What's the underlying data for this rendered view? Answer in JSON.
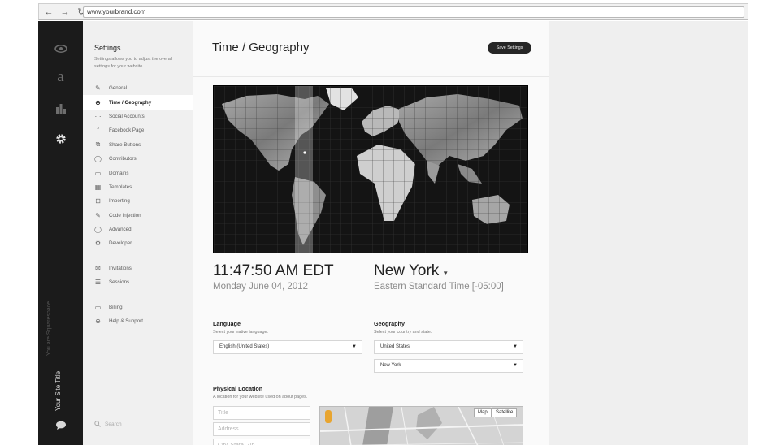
{
  "browser": {
    "url": "www.yourbrand.com",
    "back_glyph": "←",
    "forward_glyph": "→",
    "reload_glyph": "↻"
  },
  "rail": {
    "icons": [
      "eye-icon",
      "font-a-icon",
      "bar-chart-icon",
      "gear-icon"
    ],
    "a_glyph": "a",
    "site_title": "Your Site Title",
    "watermark": "You are Squarespace."
  },
  "settings_panel": {
    "heading": "Settings",
    "description": "Settings allows you to adjust the overall settings for your website.",
    "groups": [
      [
        {
          "label": "General",
          "icon": "wrench-icon",
          "glyph": "✎"
        },
        {
          "label": "Time / Geography",
          "icon": "globe-icon",
          "glyph": "⊕",
          "active": true
        },
        {
          "label": "Social Accounts",
          "icon": "share-icon",
          "glyph": "⋯"
        },
        {
          "label": "Facebook Page",
          "icon": "facebook-icon",
          "glyph": "f"
        },
        {
          "label": "Share Buttons",
          "icon": "share-buttons-icon",
          "glyph": "⧉"
        },
        {
          "label": "Contributors",
          "icon": "contributors-icon",
          "glyph": "◯"
        },
        {
          "label": "Domains",
          "icon": "domains-icon",
          "glyph": "▭"
        },
        {
          "label": "Templates",
          "icon": "templates-icon",
          "glyph": "▦"
        },
        {
          "label": "Importing",
          "icon": "importing-icon",
          "glyph": "⊞"
        },
        {
          "label": "Code Injection",
          "icon": "code-icon",
          "glyph": "✎"
        },
        {
          "label": "Advanced",
          "icon": "advanced-icon",
          "glyph": "◯"
        },
        {
          "label": "Developer",
          "icon": "developer-icon",
          "glyph": "⚙"
        }
      ],
      [
        {
          "label": "Invitations",
          "icon": "envelope-icon",
          "glyph": "✉"
        },
        {
          "label": "Sessions",
          "icon": "sessions-icon",
          "glyph": "☰"
        }
      ],
      [
        {
          "label": "Billing",
          "icon": "credit-card-icon",
          "glyph": "▭"
        },
        {
          "label": "Help & Support",
          "icon": "help-icon",
          "glyph": "⊕"
        }
      ]
    ],
    "search_placeholder": "Search"
  },
  "main": {
    "title": "Time / Geography",
    "save_label": "Save Settings",
    "time": "11:47:50 AM EDT",
    "date": "Monday June 04, 2012",
    "city": "New York",
    "timezone": "Eastern Standard Time [-05:00]",
    "language": {
      "label": "Language",
      "help": "Select your native language.",
      "value": "English (United States)"
    },
    "geography": {
      "label": "Geography",
      "help": "Select your country and state.",
      "country": "United States",
      "state": "New York"
    },
    "physical_location": {
      "label": "Physical Location",
      "help": "A location for your website used on about pages.",
      "title_placeholder": "Title",
      "address_placeholder": "Address",
      "city_placeholder": "City, State, Zip",
      "map_btn": "Map",
      "satellite_btn": "Satellite"
    }
  },
  "colors": {
    "rail_bg": "#1b1b1b",
    "save_button_bg": "#262626",
    "map_bg": "#141414",
    "day_band": "#6e6e6e"
  }
}
